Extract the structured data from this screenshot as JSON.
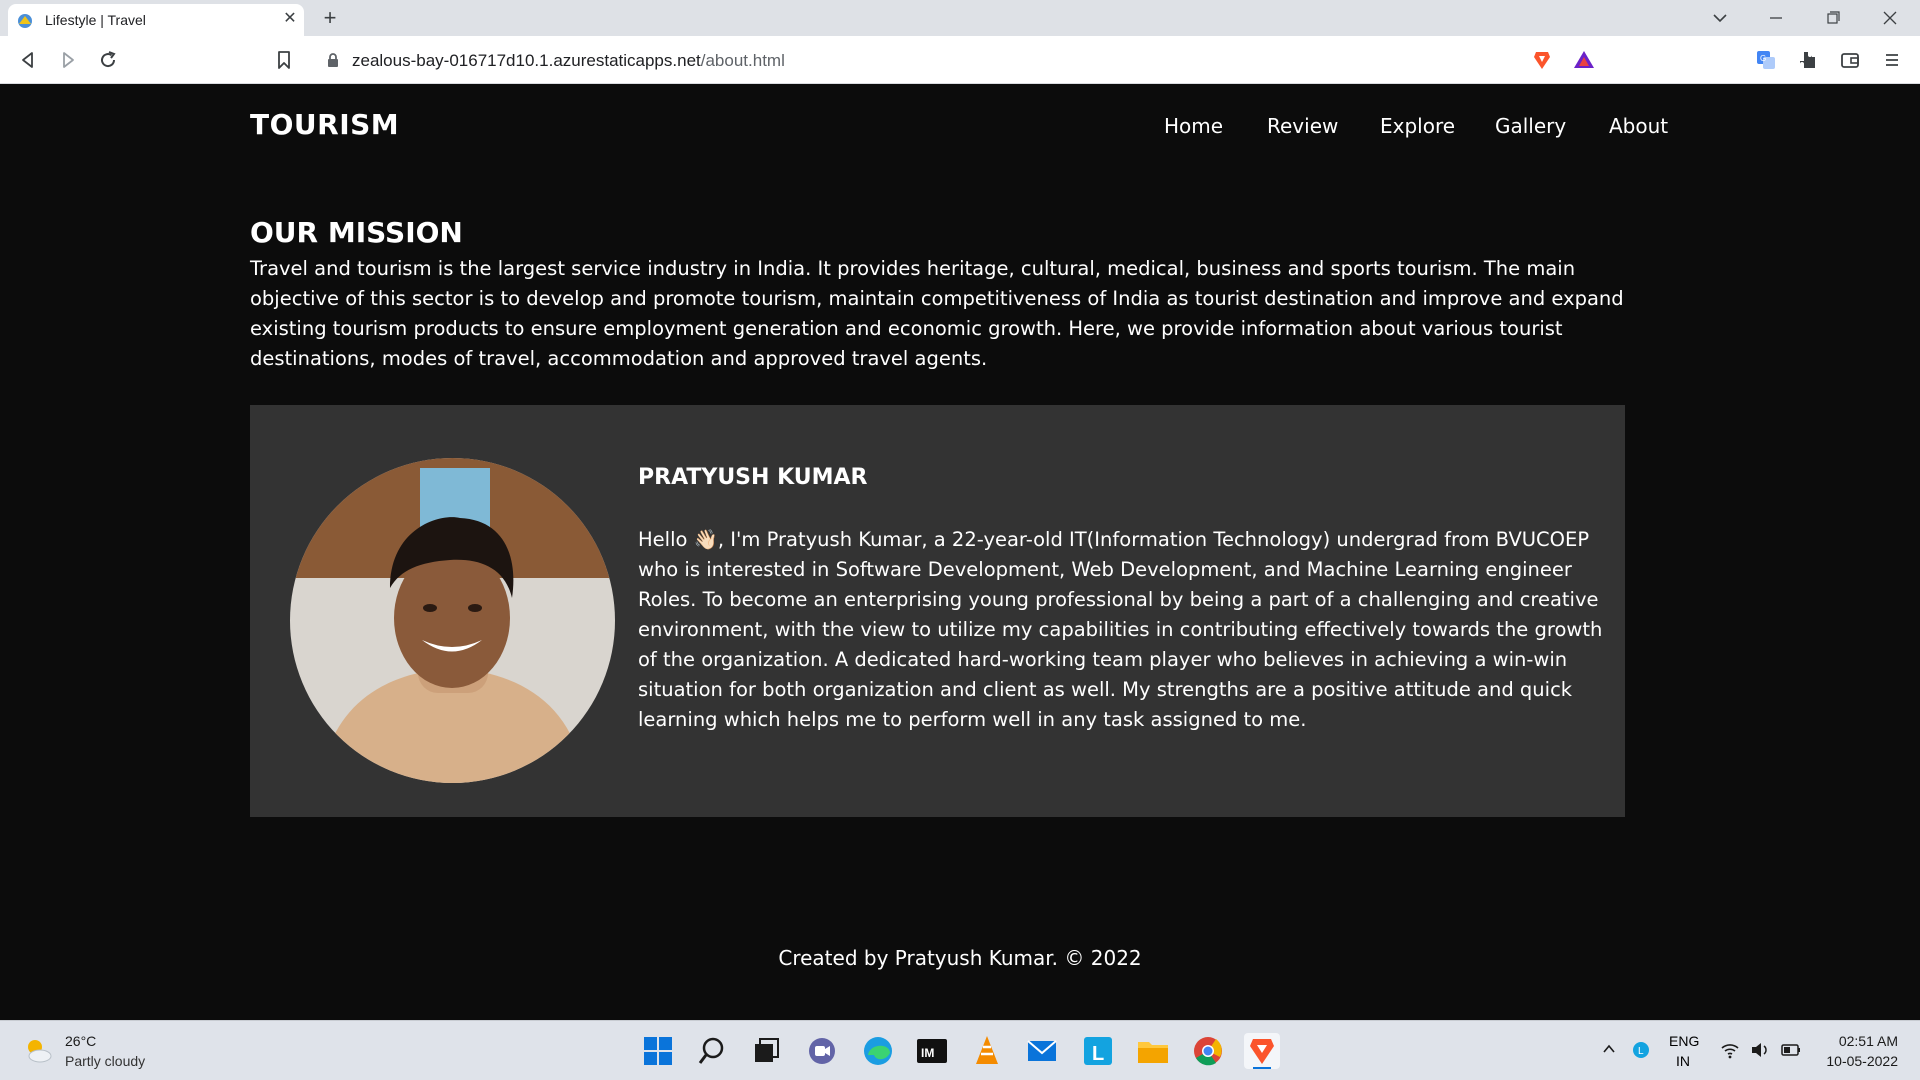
{
  "browser": {
    "tab_title": "Lifestyle | Travel",
    "url_host": "zealous-bay-016717d10.1.azurestaticapps.net",
    "url_path": "/about.html"
  },
  "site": {
    "brand": "TOURISM",
    "nav": [
      "Home",
      "Review",
      "Explore",
      "Gallery",
      "About"
    ]
  },
  "mission": {
    "title": "OUR MISSION",
    "text": "Travel and tourism is the largest service industry in India. It provides heritage, cultural, medical, business and sports tourism. The main objective of this sector is to develop and promote tourism, maintain competitiveness of India as tourist destination and improve and expand existing tourism products to ensure employment generation and economic growth. Here, we provide information about various tourist destinations, modes of travel, accommodation and approved travel agents."
  },
  "profile": {
    "name": "PRATYUSH KUMAR",
    "bio": "Hello 👋🏻, I'm Pratyush Kumar, a 22-year-old IT(Information Technology) undergrad from BVUCOEP who is interested in Software Development, Web Development, and Machine Learning engineer Roles. To become an enterprising young professional by being a part of a challenging and creative environment, with the view to utilize my capabilities in contributing effectively towards the growth of the organization. A dedicated hard-working team player who believes in achieving a win-win situation for both organization and client as well. My strengths are a positive attitude and quick learning which helps me to perform well in any task assigned to me."
  },
  "footer": {
    "text": "Created by Pratyush Kumar. © 2022"
  },
  "taskbar": {
    "weather_temp": "26°C",
    "weather_desc": "Partly cloudy",
    "lang_line1": "ENG",
    "lang_line2": "IN",
    "time": "02:51 AM",
    "date": "10-05-2022"
  },
  "colors": {
    "page_bg": "#0c0c0c",
    "card_bg": "#333333",
    "text": "#ffffff"
  }
}
